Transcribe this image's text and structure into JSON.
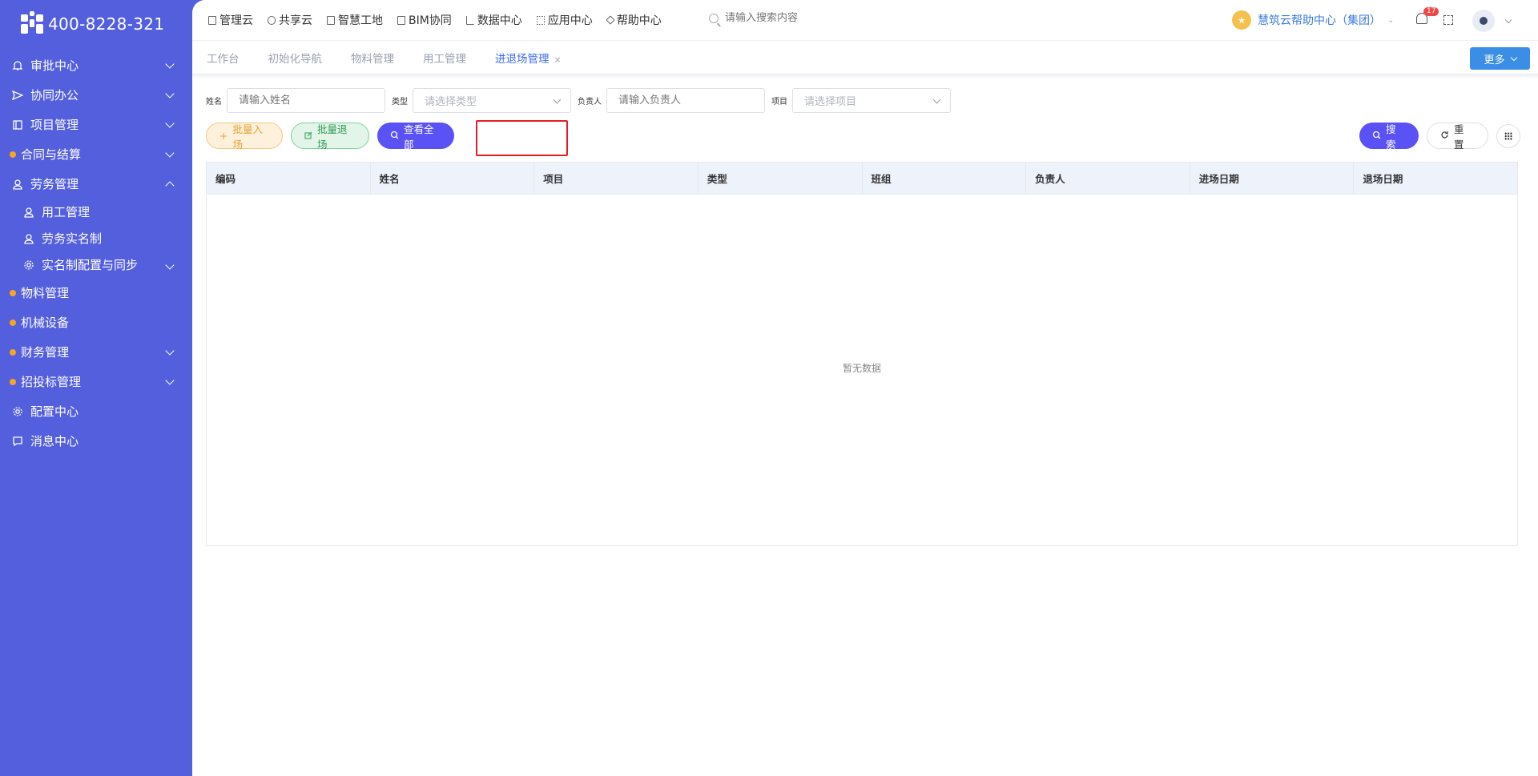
{
  "brand": {
    "phone": "400-8228-321"
  },
  "sidebar": {
    "items": [
      {
        "label": "审批中心",
        "icon": "bell-icon",
        "expandable": true
      },
      {
        "label": "协同办公",
        "icon": "send-icon",
        "expandable": true
      },
      {
        "label": "项目管理",
        "icon": "book-icon",
        "expandable": true
      },
      {
        "label": "合同与结算",
        "icon": "dot-icon",
        "expandable": true
      },
      {
        "label": "劳务管理",
        "icon": "user-icon",
        "expandable": true,
        "expanded": true
      },
      {
        "label": "用工管理",
        "icon": "user-icon",
        "sub": true
      },
      {
        "label": "劳务实名制",
        "icon": "user-icon",
        "sub": true
      },
      {
        "label": "实名制配置与同步",
        "icon": "gear-icon",
        "sub": true,
        "expandable": true
      },
      {
        "label": "物料管理",
        "icon": "dot-icon"
      },
      {
        "label": "机械设备",
        "icon": "dot-icon"
      },
      {
        "label": "财务管理",
        "icon": "dot-icon",
        "expandable": true
      },
      {
        "label": "招投标管理",
        "icon": "dot-icon",
        "expandable": true
      },
      {
        "label": "配置中心",
        "icon": "gear-icon"
      },
      {
        "label": "消息中心",
        "icon": "message-icon"
      }
    ]
  },
  "topnav": {
    "items": [
      "管理云",
      "共享云",
      "智慧工地",
      "BIM协同",
      "数据中心",
      "应用中心",
      "帮助中心"
    ],
    "search_placeholder": "请输入搜索内容",
    "help_center": "慧筑云帮助中心（集团）",
    "notification_count": "17"
  },
  "tabs": {
    "items": [
      "工作台",
      "初始化导航",
      "物料管理",
      "用工管理",
      "进退场管理"
    ],
    "active_index": 4,
    "more_label": "更多"
  },
  "filters": {
    "name_label": "姓名",
    "name_placeholder": "请输入姓名",
    "type_label": "类型",
    "type_placeholder": "请选择类型",
    "owner_label": "负责人",
    "owner_placeholder": "请输入负责人",
    "project_label": "项目",
    "project_placeholder": "请选择项目"
  },
  "actions": {
    "batch_enter": "批量入场",
    "batch_exit": "批量退场",
    "view_all": "查看全部",
    "search": "搜 索",
    "reset": "重 置"
  },
  "table": {
    "columns": [
      "编码",
      "姓名",
      "项目",
      "类型",
      "班组",
      "负责人",
      "进场日期",
      "退场日期"
    ],
    "rows": [],
    "empty_text": "暂无数据"
  },
  "colors": {
    "sidebar": "#545fde",
    "primary": "#5a52f5",
    "link": "#3b6cf0",
    "highlight": "#e51c23"
  }
}
